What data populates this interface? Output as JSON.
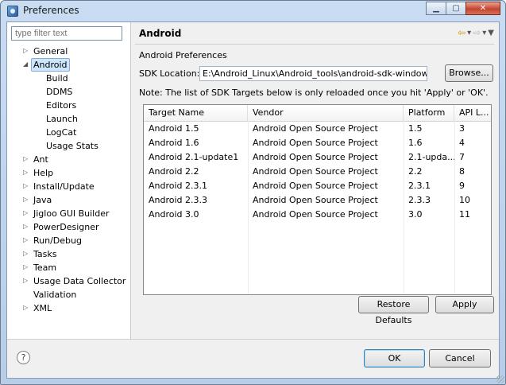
{
  "window": {
    "title": "Preferences"
  },
  "filter": {
    "placeholder": "type filter text"
  },
  "tree": [
    {
      "label": "General",
      "level": 0,
      "state": "collapsed",
      "selected": false
    },
    {
      "label": "Android",
      "level": 0,
      "state": "expanded",
      "selected": true
    },
    {
      "label": "Build",
      "level": 1,
      "state": "leaf",
      "selected": false
    },
    {
      "label": "DDMS",
      "level": 1,
      "state": "leaf",
      "selected": false
    },
    {
      "label": "Editors",
      "level": 1,
      "state": "leaf",
      "selected": false
    },
    {
      "label": "Launch",
      "level": 1,
      "state": "leaf",
      "selected": false
    },
    {
      "label": "LogCat",
      "level": 1,
      "state": "leaf",
      "selected": false
    },
    {
      "label": "Usage Stats",
      "level": 1,
      "state": "leaf",
      "selected": false
    },
    {
      "label": "Ant",
      "level": 0,
      "state": "collapsed",
      "selected": false
    },
    {
      "label": "Help",
      "level": 0,
      "state": "collapsed",
      "selected": false
    },
    {
      "label": "Install/Update",
      "level": 0,
      "state": "collapsed",
      "selected": false
    },
    {
      "label": "Java",
      "level": 0,
      "state": "collapsed",
      "selected": false
    },
    {
      "label": "Jigloo GUI Builder",
      "level": 0,
      "state": "collapsed",
      "selected": false
    },
    {
      "label": "PowerDesigner",
      "level": 0,
      "state": "collapsed",
      "selected": false
    },
    {
      "label": "Run/Debug",
      "level": 0,
      "state": "collapsed",
      "selected": false
    },
    {
      "label": "Tasks",
      "level": 0,
      "state": "collapsed",
      "selected": false
    },
    {
      "label": "Team",
      "level": 0,
      "state": "collapsed",
      "selected": false
    },
    {
      "label": "Usage Data Collector",
      "level": 0,
      "state": "collapsed",
      "selected": false
    },
    {
      "label": "Validation",
      "level": 0,
      "state": "leaf",
      "selected": false
    },
    {
      "label": "XML",
      "level": 0,
      "state": "collapsed",
      "selected": false
    }
  ],
  "page": {
    "title": "Android",
    "section_label": "Android Preferences",
    "sdk_label": "SDK Location:",
    "sdk_value": "E:\\Android_Linux\\Android_tools\\android-sdk-windows",
    "browse_label": "Browse...",
    "note": "Note: The list of SDK Targets below is only reloaded once you hit 'Apply' or 'OK'.",
    "table": {
      "columns": [
        "Target Name",
        "Vendor",
        "Platform",
        "API L..."
      ],
      "rows": [
        [
          "Android 1.5",
          "Android Open Source Project",
          "1.5",
          "3"
        ],
        [
          "Android 1.6",
          "Android Open Source Project",
          "1.6",
          "4"
        ],
        [
          "Android 2.1-update1",
          "Android Open Source Project",
          "2.1-upda...",
          "7"
        ],
        [
          "Android 2.2",
          "Android Open Source Project",
          "2.2",
          "8"
        ],
        [
          "Android 2.3.1",
          "Android Open Source Project",
          "2.3.1",
          "9"
        ],
        [
          "Android 2.3.3",
          "Android Open Source Project",
          "2.3.3",
          "10"
        ],
        [
          "Android 3.0",
          "Android Open Source Project",
          "3.0",
          "11"
        ]
      ]
    },
    "restore_defaults_label": "Restore Defaults",
    "apply_label": "Apply"
  },
  "footer": {
    "ok_label": "OK",
    "cancel_label": "Cancel",
    "help_symbol": "?"
  },
  "icons": {
    "app": "eclipse-icon",
    "back": "back-arrow-icon",
    "forward": "forward-arrow-icon",
    "menu": "view-menu-icon",
    "help": "help-icon"
  },
  "colors": {
    "selection": "#cde6fb",
    "title_bar": "#c9dcf2",
    "close_button": "#c4452d"
  }
}
